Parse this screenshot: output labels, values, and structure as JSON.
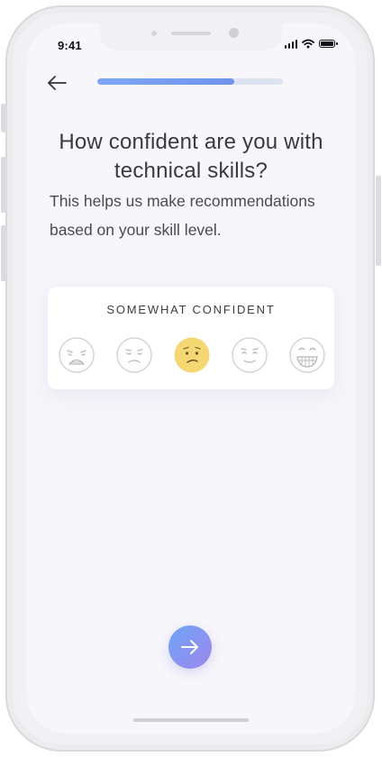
{
  "status_bar": {
    "time": "9:41"
  },
  "question": {
    "title": "How confident are you with technical skills?",
    "subtitle": "This helps us make recommendations based on your skill level."
  },
  "progress": {
    "value": 0.74
  },
  "rating": {
    "selected_label": "SOMEWHAT CONFIDENT",
    "selected_index": 2,
    "options": [
      {
        "icon": "crying-face-icon",
        "selected": false
      },
      {
        "icon": "unhappy-face-icon",
        "selected": false
      },
      {
        "icon": "confused-face-icon",
        "selected": true
      },
      {
        "icon": "content-face-icon",
        "selected": false
      },
      {
        "icon": "grinning-face-icon",
        "selected": false
      }
    ]
  },
  "colors": {
    "accent_gradient_start": "#6fa5f5",
    "accent_gradient_end": "#9d86ef",
    "selected_face": "#f5d874",
    "background": "#f7f6fb"
  }
}
